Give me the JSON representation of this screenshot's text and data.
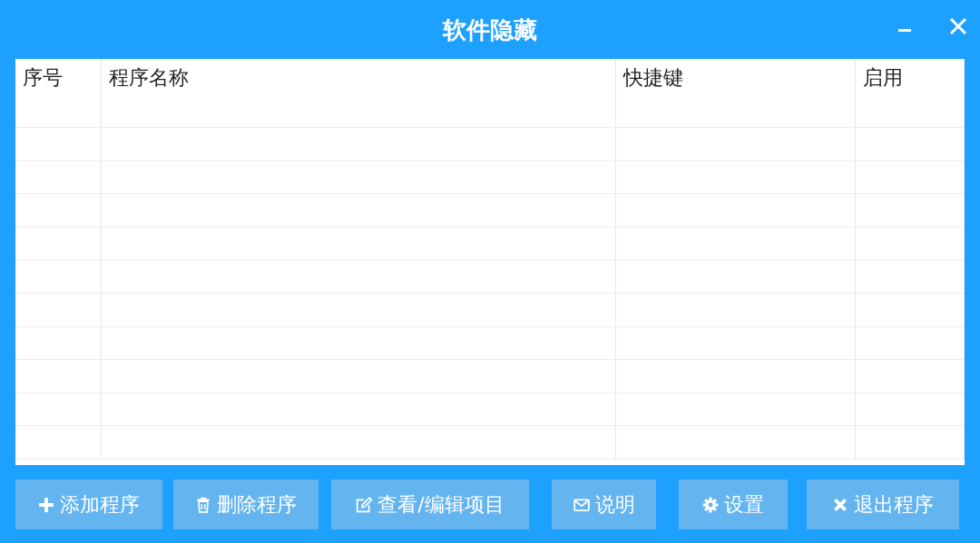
{
  "window": {
    "title": "软件隐藏"
  },
  "table": {
    "columns": [
      "序号",
      "程序名称",
      "快捷键",
      "启用"
    ]
  },
  "buttons": [
    {
      "label": "添加程序"
    },
    {
      "label": "删除程序"
    },
    {
      "label": "查看/编辑项目"
    },
    {
      "label": "说明"
    },
    {
      "label": "设置"
    },
    {
      "label": "退出程序"
    }
  ]
}
